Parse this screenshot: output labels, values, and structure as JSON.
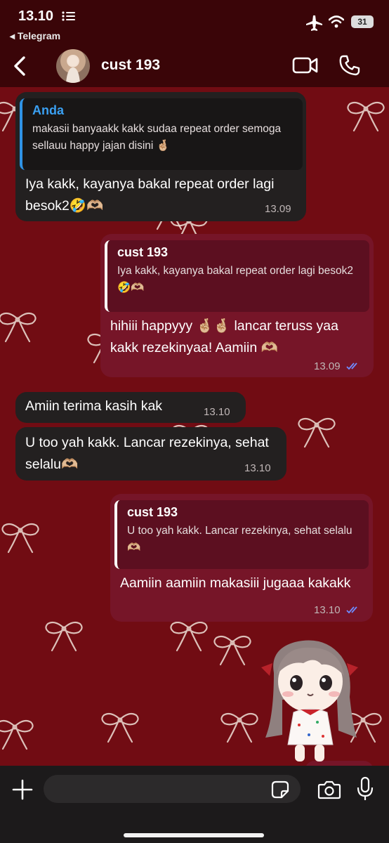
{
  "status_bar": {
    "time": "13.10",
    "back_app": "◂ Telegram",
    "battery": "31"
  },
  "header": {
    "contact_name": "cust 193"
  },
  "messages": [
    {
      "direction": "in",
      "reply_name": "Anda",
      "reply_text": "makasii banyaakk kakk sudaa repeat order semoga sellauu happy jajan disini 🤞🏼",
      "text": "Iya kakk, kayanya bakal repeat order lagi besok2🤣🫶🏼",
      "time": "13.09"
    },
    {
      "direction": "out",
      "reply_name": "cust 193",
      "reply_text": "Iya kakk, kayanya bakal repeat order lagi besok2🤣🫶🏼",
      "text": "hihiii happyyy 🤞🏼🤞🏼 lancar teruss yaa kakk rezekinyaa! Aamiin 🫶🏼",
      "time": "13.09"
    },
    {
      "direction": "in",
      "text": "Amiin terima kasih kak",
      "time": "13.10"
    },
    {
      "direction": "in",
      "text": "U too yah kakk. Lancar rezekinya, sehat selalu🫶🏼",
      "time": "13.10"
    },
    {
      "direction": "out",
      "reply_name": "cust 193",
      "reply_text": "U too yah kakk. Lancar rezekinya, sehat selalu🫶🏼",
      "text": "Aamiin aamiin makasiii jugaaa kakakk",
      "time": "13.10"
    }
  ],
  "composer": {
    "placeholder": ""
  },
  "icons": {
    "back": "chevron-left-icon",
    "video": "video-camera-icon",
    "call": "phone-icon",
    "attach": "plus-icon",
    "sticker": "sticker-icon",
    "camera": "camera-icon",
    "mic": "microphone-icon",
    "read": "double-check-icon"
  },
  "colors": {
    "wallpaper": "#710c13",
    "incoming_bubble": "#232020",
    "outgoing_bubble": "#761528",
    "reply_accent": "#2f93e5",
    "read_ticks": "#6f8cff"
  }
}
